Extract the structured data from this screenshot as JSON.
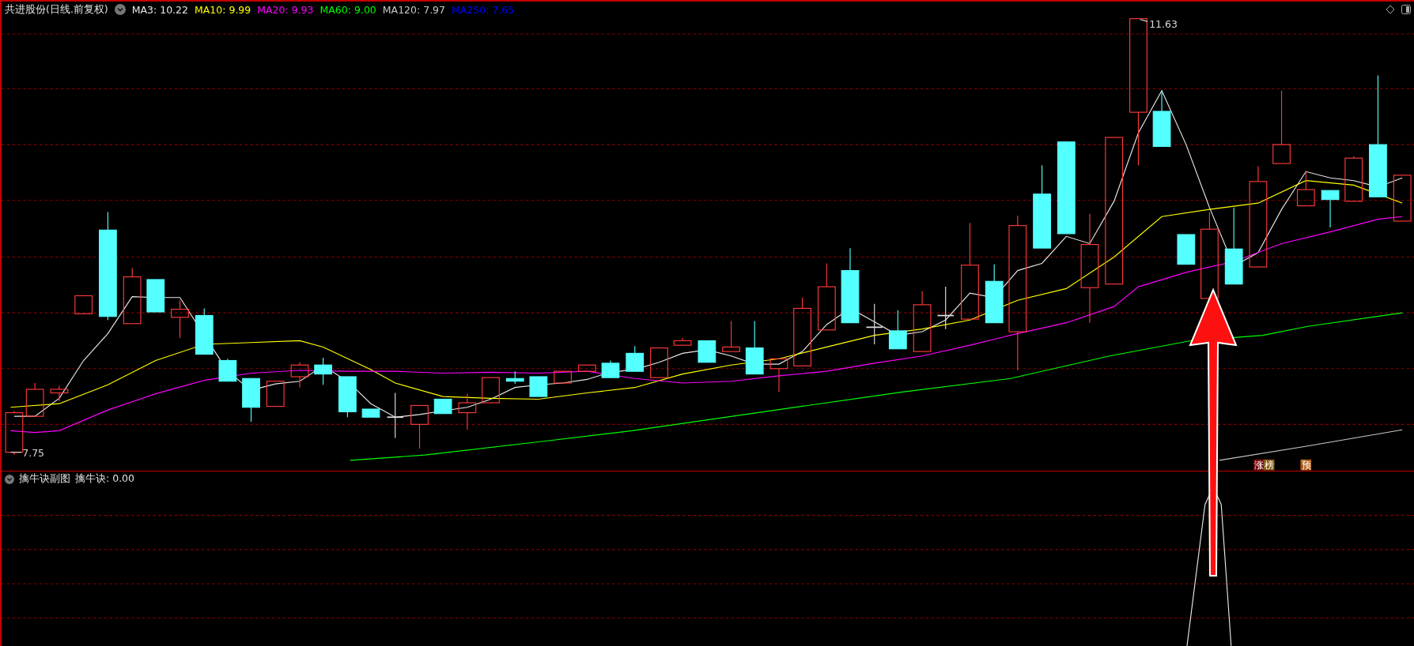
{
  "title": "共进股份(日线.前复权)",
  "moving_averages": [
    {
      "text": "MA3: 10.22",
      "color": "#e8e8e8"
    },
    {
      "text": "MA10: 9.99",
      "color": "#ffff00"
    },
    {
      "text": "MA20: 9.93",
      "color": "#ff00ff"
    },
    {
      "text": "MA60: 9.00",
      "color": "#00ff00"
    },
    {
      "text": "MA120: 7.97",
      "color": "#c8c8c8"
    },
    {
      "text": "MA250: 7.65",
      "color": "#0000ff"
    }
  ],
  "high_label": "11.63",
  "low_label": "7.75",
  "tags": [
    {
      "text": "涨",
      "color": "#7a0a0a"
    },
    {
      "text": "榜",
      "color": "#8a5a10"
    },
    {
      "text": "预",
      "color": "#b05a14"
    }
  ],
  "sub_panel": {
    "title": "擒牛诀副图",
    "indicator": "擒牛诀: 0.00"
  }
}
